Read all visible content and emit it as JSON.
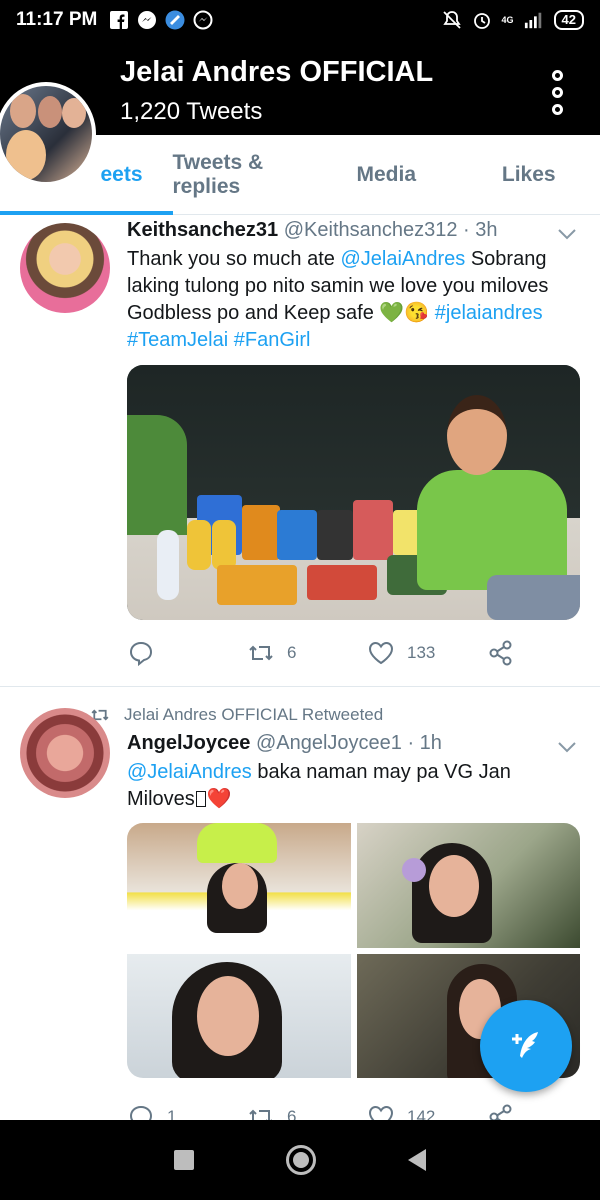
{
  "status_bar": {
    "time": "11:17 PM",
    "network": "4G",
    "battery": "42",
    "icons_left": [
      "facebook-icon",
      "messenger-icon",
      "verified-app-icon",
      "messenger-outline-icon"
    ],
    "icons_right": [
      "mute-bell-icon",
      "alarm-icon",
      "signal-icon",
      "battery-icon"
    ]
  },
  "header": {
    "title": "Jelai Andres OFFICIAL",
    "tweet_count": "1,220 Tweets"
  },
  "tabs": [
    {
      "label": "Tweets",
      "visible_label": "eets",
      "active": true
    },
    {
      "label": "Tweets & replies",
      "active": false
    },
    {
      "label": "Media",
      "active": false
    },
    {
      "label": "Likes",
      "active": false
    }
  ],
  "tweets": [
    {
      "username": "Keithsanchez31",
      "handle_time": "@Keithsanchez312 · 3h",
      "text": {
        "p1": "Thank you so much ate ",
        "mention": "@JelaiAndres",
        "p2": "  Sobrang laking tulong po nito samin we love you miloves Godbless po and Keep safe 💚😘 ",
        "tag1": "#jelaiandres",
        "tag2": "#TeamJelai",
        "tag3": "#FanGirl"
      },
      "replies": "",
      "retweets": "6",
      "likes": "133"
    },
    {
      "retweet_label": "Jelai Andres OFFICIAL Retweeted",
      "username": "AngelJoycee",
      "handle_time": "@AngelJoycee1 · 1h",
      "text": {
        "mention": "@JelaiAndres",
        "p1": " baka naman may pa VG Jan Miloves",
        "heart": "❤️"
      },
      "replies": "1",
      "retweets": "6",
      "likes": "142"
    }
  ],
  "colors": {
    "accent": "#1da1f2",
    "muted": "#657786",
    "text": "#14171a",
    "header_bg": "#000000"
  }
}
